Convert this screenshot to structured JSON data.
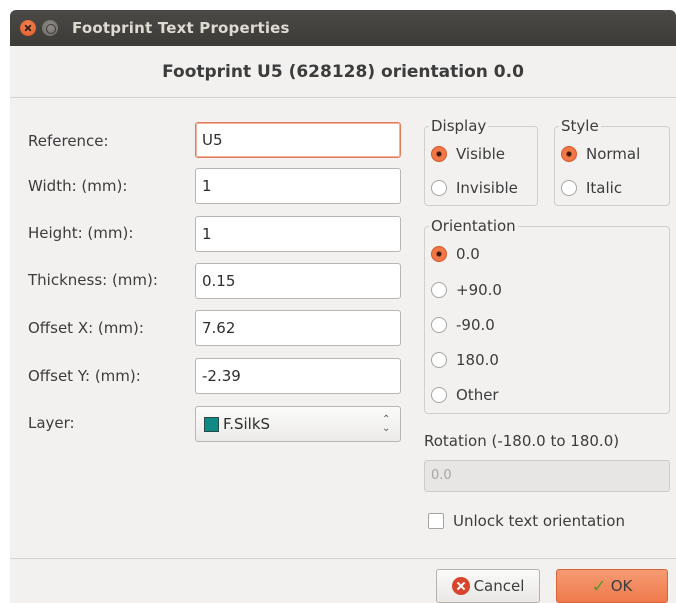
{
  "window": {
    "title": "Footprint Text Properties"
  },
  "header": {
    "title": "Footprint U5 (628128) orientation 0.0"
  },
  "fields": {
    "reference": {
      "label": "Reference:",
      "value": "U5"
    },
    "width": {
      "label": "Width: (mm):",
      "value": "1"
    },
    "height": {
      "label": "Height: (mm):",
      "value": "1"
    },
    "thickness": {
      "label": "Thickness: (mm):",
      "value": "0.15"
    },
    "offset_x": {
      "label": "Offset X: (mm):",
      "value": "7.62"
    },
    "offset_y": {
      "label": "Offset Y: (mm):",
      "value": "-2.39"
    },
    "layer": {
      "label": "Layer:",
      "value": "F.SilkS",
      "color": "#0f8a85"
    }
  },
  "display": {
    "title": "Display",
    "options": [
      "Visible",
      "Invisible"
    ],
    "selected": "Visible"
  },
  "style": {
    "title": "Style",
    "options": [
      "Normal",
      "Italic"
    ],
    "selected": "Normal"
  },
  "orientation": {
    "title": "Orientation",
    "options": [
      "0.0",
      "+90.0",
      "-90.0",
      "180.0",
      "Other"
    ],
    "selected": "0.0"
  },
  "rotation": {
    "label": "Rotation (-180.0 to 180.0)",
    "placeholder": "0.0"
  },
  "unlock": {
    "label": "Unlock text orientation",
    "checked": false
  },
  "buttons": {
    "cancel": "Cancel",
    "ok": "OK"
  },
  "colors": {
    "accent": "#ef7b4c",
    "titlebar": "#3c3b37"
  }
}
